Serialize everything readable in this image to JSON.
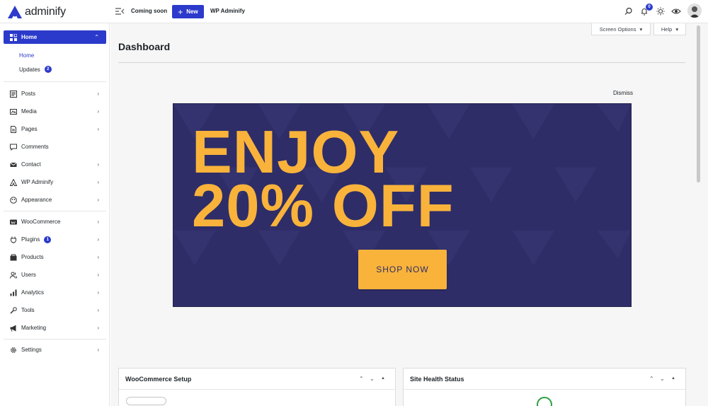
{
  "brand": {
    "name": "adminify",
    "color": "#2c3acb"
  },
  "topbar": {
    "coming_soon": "Coming soon",
    "new_label": "New",
    "site_name": "WP Adminify",
    "notifications_count": "0"
  },
  "sidebar": {
    "active": {
      "label": "Home"
    },
    "submenu": [
      {
        "label": "Home"
      },
      {
        "label": "Updates",
        "badge": "2"
      }
    ],
    "items": [
      {
        "label": "Posts"
      },
      {
        "label": "Media"
      },
      {
        "label": "Pages"
      },
      {
        "label": "Comments"
      },
      {
        "label": "Contact"
      },
      {
        "label": "WP Adminify"
      },
      {
        "label": "Appearance"
      },
      {
        "label": "WooCommerce"
      },
      {
        "label": "Plugins",
        "badge": "1"
      },
      {
        "label": "Products"
      },
      {
        "label": "Users"
      },
      {
        "label": "Analytics"
      },
      {
        "label": "Tools"
      },
      {
        "label": "Marketing"
      },
      {
        "label": "Settings"
      }
    ]
  },
  "main": {
    "screen_options": "Screen Options",
    "help": "Help",
    "title": "Dashboard",
    "dismiss": "Dismiss",
    "banner": {
      "line1": "ENJOY",
      "line2": "20% OFF",
      "button": "SHOP NOW",
      "bg_color": "#2e2d68",
      "accent_color": "#f9b33b"
    },
    "panels": [
      {
        "title": "WooCommerce Setup"
      },
      {
        "title": "Site Health Status"
      }
    ]
  }
}
